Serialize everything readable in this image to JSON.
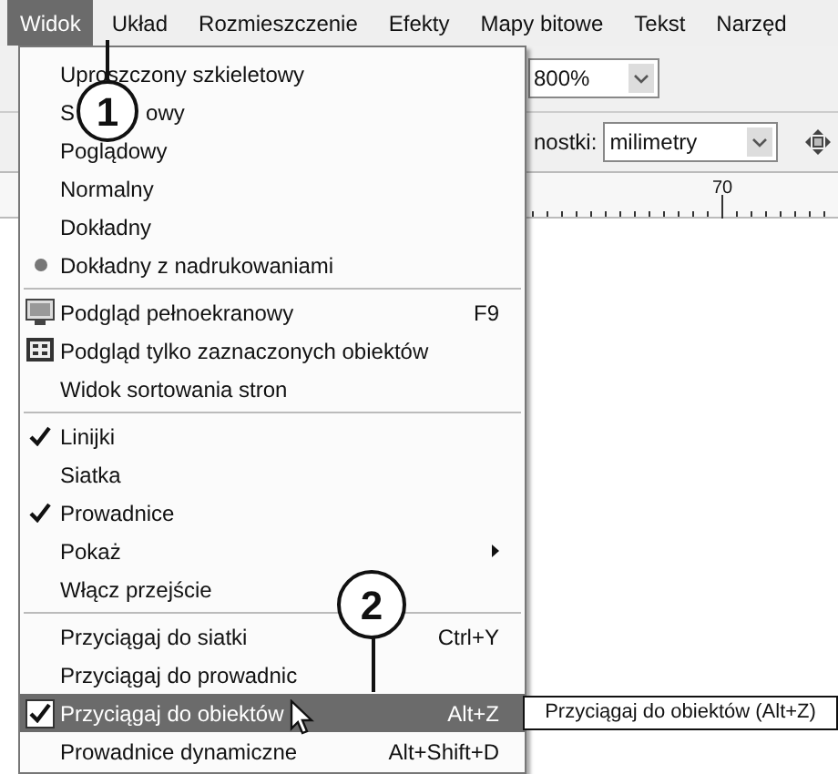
{
  "menubar": [
    {
      "label": "Widok",
      "selected": true
    },
    {
      "label": "Układ",
      "selected": false
    },
    {
      "label": "Rozmieszczenie",
      "selected": false
    },
    {
      "label": "Efekty",
      "selected": false
    },
    {
      "label": "Mapy bitowe",
      "selected": false
    },
    {
      "label": "Tekst",
      "selected": false
    },
    {
      "label": "Narzęd",
      "selected": false
    }
  ],
  "toolbar": {
    "zoom": "800%",
    "units_label": "nostki:",
    "units": "milimetry"
  },
  "ruler": {
    "label": "70"
  },
  "menu": [
    {
      "kind": "option",
      "label": "Uproszczony szkieletowy",
      "checked": false,
      "selected": false
    },
    {
      "kind": "option",
      "label_parts": [
        "S",
        "owy"
      ],
      "checked": false,
      "selected": false
    },
    {
      "kind": "option",
      "label": "Poglądowy",
      "checked": false,
      "selected": false
    },
    {
      "kind": "option",
      "label": "Normalny",
      "checked": false,
      "selected": false
    },
    {
      "kind": "option",
      "label": "Dokładny",
      "checked": false,
      "selected": false
    },
    {
      "kind": "option",
      "label": "Dokładny z nadrukowaniami",
      "checked": true,
      "selected": false
    },
    {
      "kind": "separator"
    },
    {
      "kind": "monitor",
      "label": "Podgląd pełnoekranowy",
      "shortcut": "F9",
      "selected": false
    },
    {
      "kind": "selection",
      "label": "Podgląd tylko zaznaczonych obiektów",
      "selected": false
    },
    {
      "kind": "command",
      "label": "Widok sortowania stron",
      "selected": false
    },
    {
      "kind": "separator"
    },
    {
      "kind": "toggle",
      "label": "Linijki",
      "checked": true,
      "selected": false
    },
    {
      "kind": "toggle",
      "label": "Siatka",
      "checked": false,
      "selected": false
    },
    {
      "kind": "toggle",
      "label": "Prowadnice",
      "checked": true,
      "selected": false
    },
    {
      "kind": "submenu",
      "label": "Pokaż",
      "selected": false
    },
    {
      "kind": "command",
      "label": "Włącz przejście",
      "selected": false
    },
    {
      "kind": "separator"
    },
    {
      "kind": "toggle",
      "label": "Przyciągaj do siatki",
      "shortcut": "Ctrl+Y",
      "checked": false,
      "selected": false
    },
    {
      "kind": "toggle",
      "label": "Przyciągaj do prowadnic",
      "checked": false,
      "selected": false
    },
    {
      "kind": "toggle",
      "label": "Przyciągaj do obiektów",
      "shortcut": "Alt+Z",
      "checked": true,
      "selected": true
    },
    {
      "kind": "toggle",
      "label": "Prowadnice dynamiczne",
      "shortcut": "Alt+Shift+D",
      "checked": false,
      "selected": false
    }
  ],
  "tooltip": "Przyciągaj do obiektów (Alt+Z)",
  "callouts": [
    "1",
    "2"
  ]
}
